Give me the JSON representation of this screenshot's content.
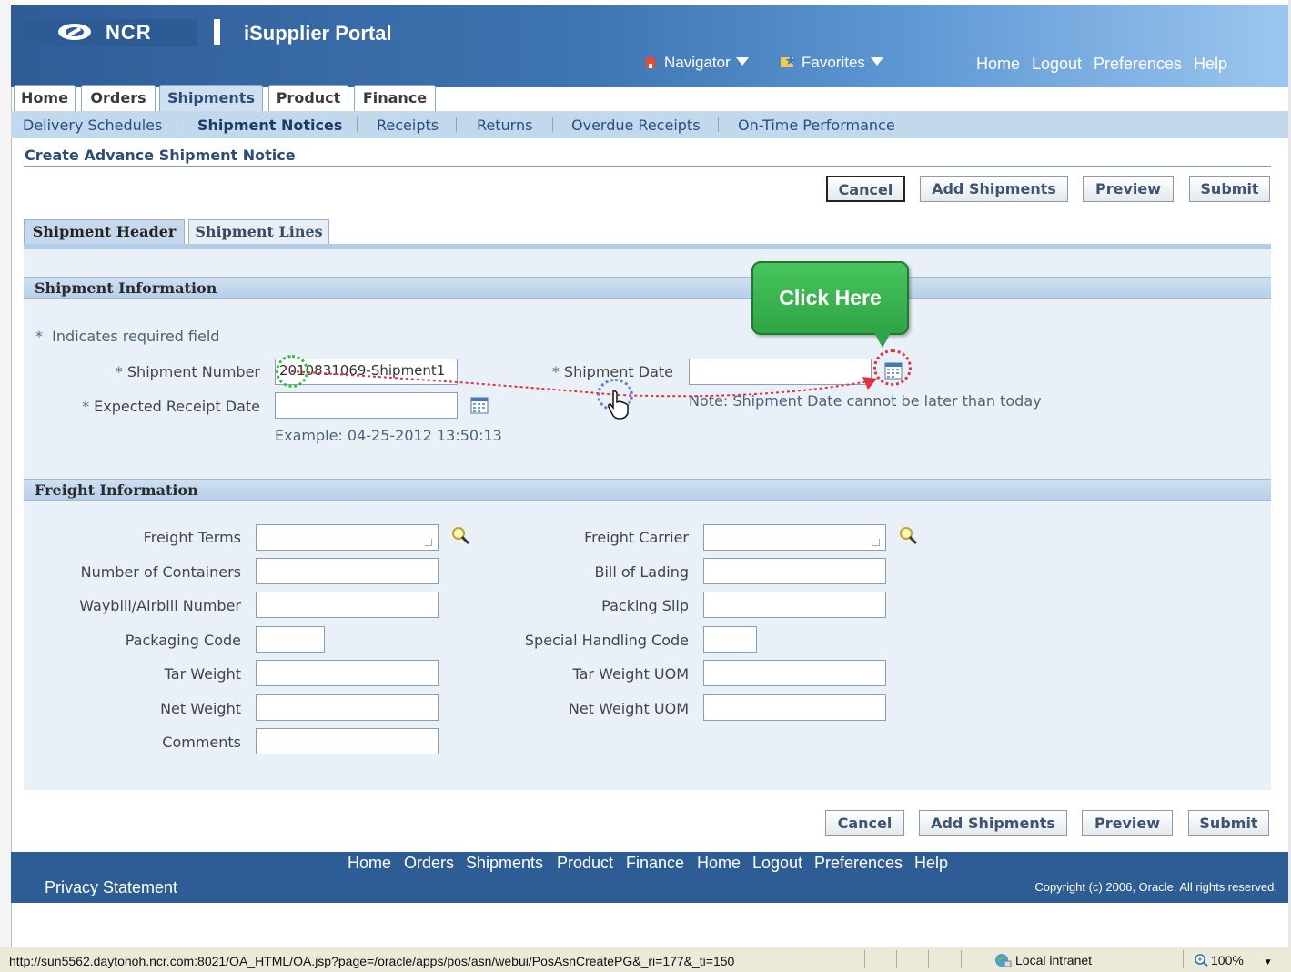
{
  "branding": {
    "logo_text": "NCR",
    "app_title": "iSupplier Portal"
  },
  "global_nav": {
    "navigator": "Navigator",
    "favorites": "Favorites",
    "links": [
      "Home",
      "Logout",
      "Preferences",
      "Help"
    ]
  },
  "tabs": [
    "Home",
    "Orders",
    "Shipments",
    "Product",
    "Finance"
  ],
  "active_tab": "Shipments",
  "subnav": [
    "Delivery Schedules",
    "Shipment Notices",
    "Receipts",
    "Returns",
    "Overdue Receipts",
    "On-Time Performance"
  ],
  "active_subnav": "Shipment Notices",
  "page_title": "Create Advance Shipment Notice",
  "buttons": {
    "cancel": "Cancel",
    "add_shipments": "Add Shipments",
    "preview": "Preview",
    "submit": "Submit"
  },
  "subtabs": [
    "Shipment Header",
    "Shipment Lines"
  ],
  "shipment_info": {
    "heading": "Shipment Information",
    "required_note": "Indicates required field",
    "shipment_number_label": "Shipment Number",
    "shipment_number_value": "2010831069-Shipment1",
    "shipment_date_label": "Shipment Date",
    "shipment_date_value": "",
    "expected_receipt_label": "Expected Receipt Date",
    "expected_receipt_value": "",
    "example": "Example: 04-25-2012 13:50:13",
    "date_note": "Note: Shipment Date cannot be later than today"
  },
  "callout": {
    "text": "Click Here"
  },
  "freight_info": {
    "heading": "Freight Information",
    "left": [
      "Freight Terms",
      "Number of Containers",
      "Waybill/Airbill Number",
      "Packaging Code",
      "Tar Weight",
      "Net Weight",
      "Comments"
    ],
    "right": [
      "Freight Carrier",
      "Bill of Lading",
      "Packing Slip",
      "Special Handling Code",
      "Tar Weight UOM",
      "Net Weight UOM"
    ]
  },
  "footer": {
    "links": [
      "Home",
      "Orders",
      "Shipments",
      "Product",
      "Finance",
      "Home",
      "Logout",
      "Preferences",
      "Help"
    ],
    "privacy": "Privacy Statement",
    "copyright": "Copyright (c) 2006, Oracle. All rights reserved."
  },
  "statusbar": {
    "url": "http://sun5562.daytonoh.ncr.com:8021/OA_HTML/OA.jsp?page=/oracle/apps/pos/asn/webui/PosAsnCreatePG&_ri=177&_ti=150",
    "zone": "Local intranet",
    "zoom": "100%"
  },
  "colors": {
    "header_blue": "#2e5d96",
    "subnav_blue": "#c2d8ed",
    "callout_green": "#2ea546",
    "panel_bg": "#eaf0f7"
  }
}
